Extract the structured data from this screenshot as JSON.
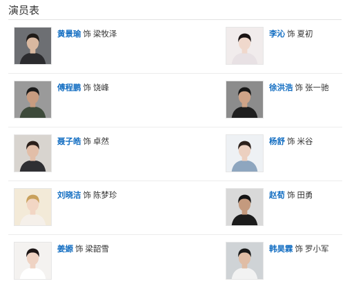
{
  "section": {
    "title": "演员表"
  },
  "as_word": "饰",
  "cast": [
    {
      "actor": "黄景瑜",
      "role": "梁牧泽",
      "bg": "#6d6f73",
      "skin": "#d9b8a0",
      "hair": "#1f1a17",
      "cloth": "#2b2b2e"
    },
    {
      "actor": "李沁",
      "role": "夏初",
      "bg": "#f1ecec",
      "skin": "#f0d8cc",
      "hair": "#1b1515",
      "cloth": "#e8e1e4"
    },
    {
      "actor": "傅程鹏",
      "role": "饶峰",
      "bg": "#9a9a9a",
      "skin": "#c89c80",
      "hair": "#1a1a1a",
      "cloth": "#3d4a3a"
    },
    {
      "actor": "徐洪浩",
      "role": "张一驰",
      "bg": "#8c8c8c",
      "skin": "#cfa488",
      "hair": "#161616",
      "cloth": "#1e1e1e"
    },
    {
      "actor": "聂子皓",
      "role": "卓然",
      "bg": "#d8d4cf",
      "skin": "#e2bea8",
      "hair": "#2a1f1a",
      "cloth": "#2f2f33"
    },
    {
      "actor": "杨舒",
      "role": "米谷",
      "bg": "#eef1f4",
      "skin": "#ecd0c0",
      "hair": "#2c211c",
      "cloth": "#8ea6bf"
    },
    {
      "actor": "刘晓洁",
      "role": "陈梦珍",
      "bg": "#f3ead8",
      "skin": "#f2d6c4",
      "hair": "#c9a15c",
      "cloth": "#f5f0ea"
    },
    {
      "actor": "赵荀",
      "role": "田勇",
      "bg": "#d9d9d9",
      "skin": "#c49a7e",
      "hair": "#141414",
      "cloth": "#1b1b1b"
    },
    {
      "actor": "姜嫄",
      "role": "梁韶雪",
      "bg": "#f4f2f0",
      "skin": "#efd3c3",
      "hair": "#1c1616",
      "cloth": "#ffffff"
    },
    {
      "actor": "韩昊霖",
      "role": "罗小军",
      "bg": "#cfd3d6",
      "skin": "#e0bda5",
      "hair": "#191919",
      "cloth": "#f2f2f2"
    }
  ]
}
